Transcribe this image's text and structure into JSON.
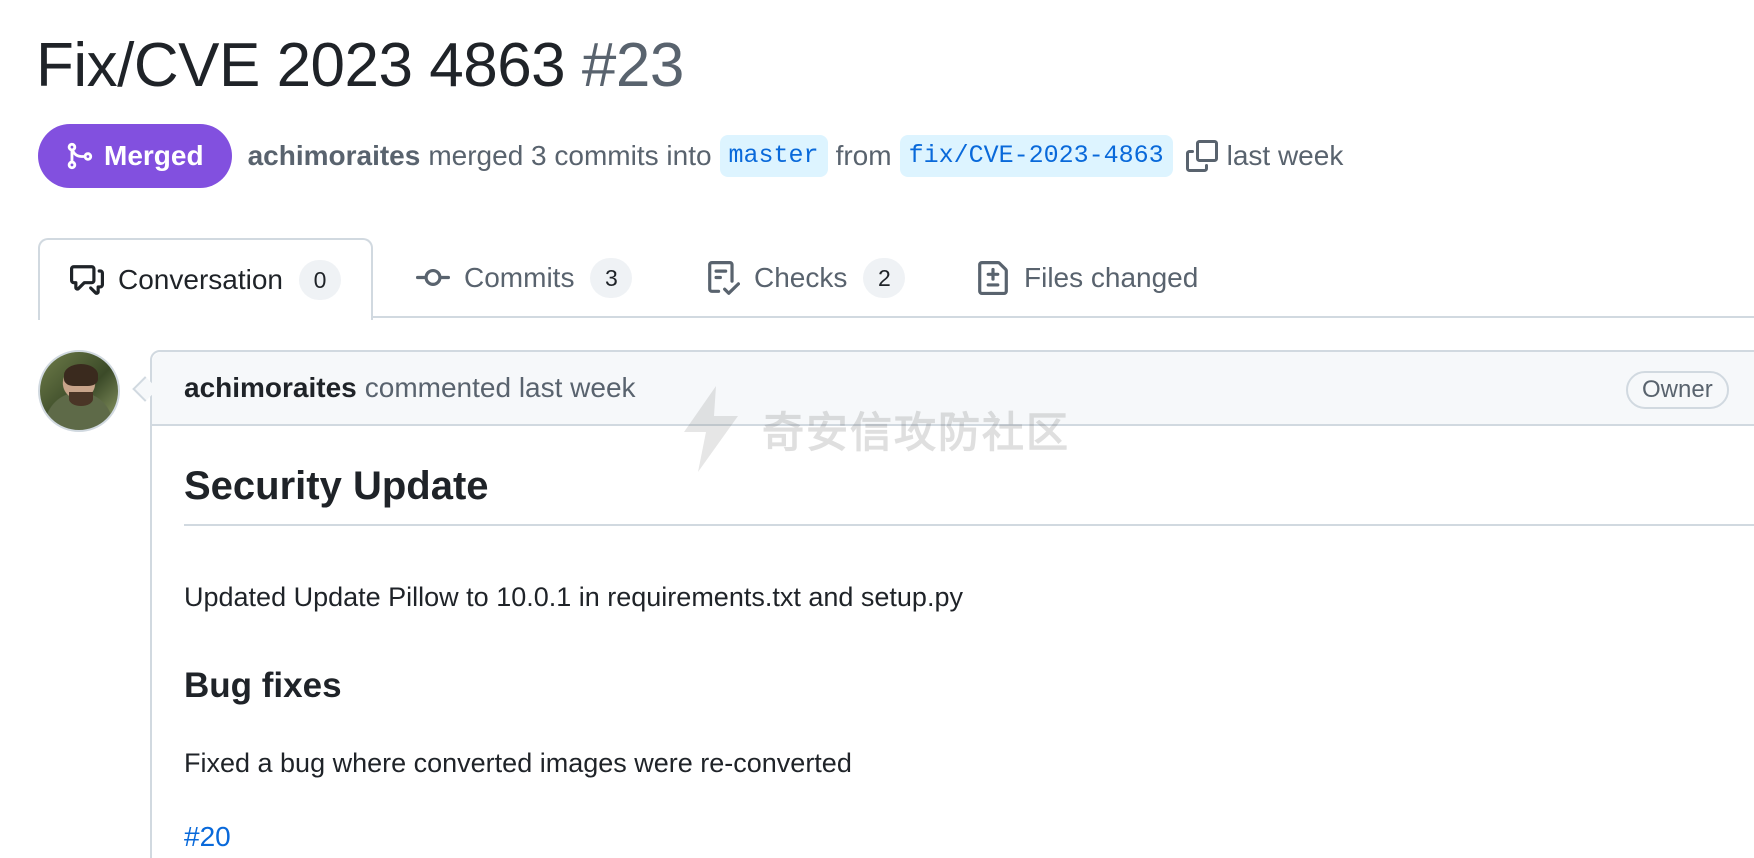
{
  "pull_request": {
    "title": "Fix/CVE 2023 4863",
    "number": "#23",
    "state": "Merged",
    "author": "achimoraites",
    "merge_text": "merged 3 commits into",
    "base_branch": "master",
    "from_text": "from",
    "head_branch": "fix/CVE-2023-4863",
    "time": "last week"
  },
  "tabs": [
    {
      "label": "Conversation",
      "count": "0",
      "icon": "comment-discussion-icon"
    },
    {
      "label": "Commits",
      "count": "3",
      "icon": "git-commit-icon"
    },
    {
      "label": "Checks",
      "count": "2",
      "icon": "checklist-icon"
    },
    {
      "label": "Files changed",
      "count": "",
      "icon": "file-diff-icon"
    }
  ],
  "comment": {
    "author": "achimoraites",
    "action": "commented last week",
    "role_label": "Owner",
    "heading": "Security Update",
    "paragraph1": "Updated Update Pillow to 10.0.1 in requirements.txt and setup.py",
    "subheading": "Bug fixes",
    "paragraph2": "Fixed a bug where converted images were re-converted",
    "issue_link": "#20"
  },
  "watermark": {
    "text": "奇安信攻防社区"
  },
  "colors": {
    "merged": "#8250df",
    "link": "#0969da",
    "branch_bg": "#ddf4ff",
    "muted": "#59636e",
    "border": "#d1d9e0"
  }
}
